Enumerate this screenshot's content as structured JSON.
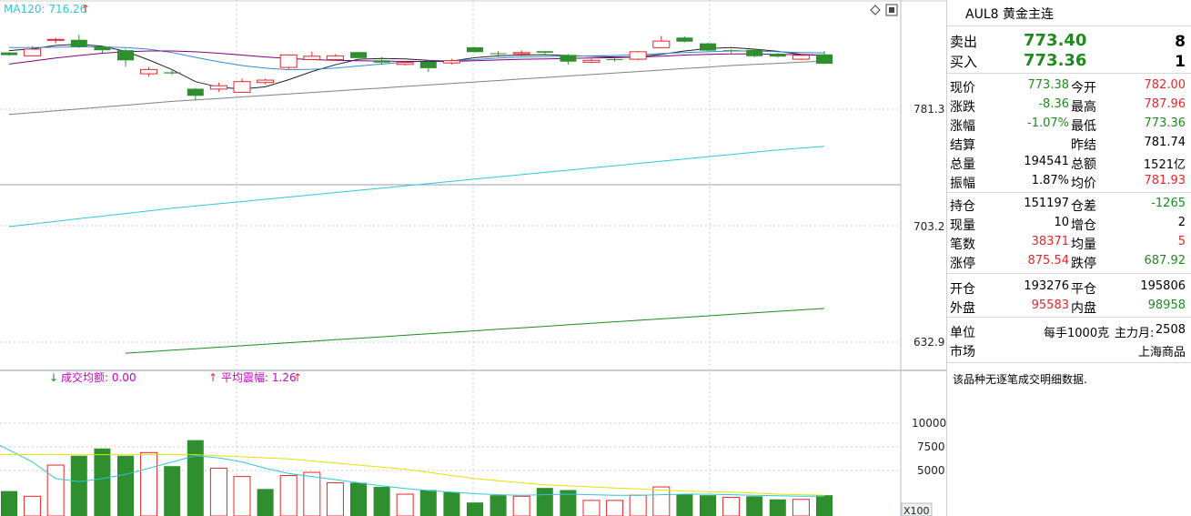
{
  "top_indicator": {
    "label": "MA120: 716.26",
    "arrow": "↑"
  },
  "vol_indicators": {
    "left_arrow": "↓",
    "left": "成交均额: 0.00",
    "right_arrow": "↑",
    "right": "平均震幅: 1.26",
    "right_arrow2": "↑"
  },
  "price_axis": [
    "781.3",
    "703.2",
    "632.9"
  ],
  "vol_axis": [
    "10000",
    "7500",
    "5000"
  ],
  "vol_multiplier": "X100",
  "panel": {
    "title": "AUL8  黄金主连",
    "sell": {
      "label": "卖出",
      "price": "773.40",
      "qty": "8"
    },
    "buy": {
      "label": "买入",
      "price": "773.36",
      "qty": "1"
    },
    "rows": [
      {
        "l1": "现价",
        "v1": "773.38",
        "c1": "green",
        "l2": "今开",
        "v2": "782.00",
        "c2": "red"
      },
      {
        "l1": "涨跌",
        "v1": "-8.36",
        "c1": "green",
        "l2": "最高",
        "v2": "787.96",
        "c2": "red"
      },
      {
        "l1": "涨幅",
        "v1": "-1.07%",
        "c1": "green",
        "l2": "最低",
        "v2": "773.36",
        "c2": "green"
      },
      {
        "l1": "结算",
        "v1": "",
        "c1": "",
        "l2": "昨结",
        "v2": "781.74",
        "c2": ""
      },
      {
        "l1": "总量",
        "v1": "194541",
        "c1": "",
        "l2": "总额",
        "v2": "1521亿",
        "c2": ""
      },
      {
        "l1": "振幅",
        "v1": "1.87%",
        "c1": "",
        "l2": "均价",
        "v2": "781.93",
        "c2": "red"
      }
    ],
    "rows2": [
      {
        "l1": "持仓",
        "v1": "151197",
        "c1": "",
        "l2": "仓差",
        "v2": "-1265",
        "c2": "green"
      },
      {
        "l1": "现量",
        "v1": "10",
        "c1": "",
        "l2": "增仓",
        "v2": "2",
        "c2": ""
      },
      {
        "l1": "笔数",
        "v1": "38371",
        "c1": "red",
        "l2": "均量",
        "v2": "5",
        "c2": "red"
      },
      {
        "l1": "涨停",
        "v1": "875.54",
        "c1": "red",
        "l2": "跌停",
        "v2": "687.92",
        "c2": "green"
      }
    ],
    "rows3": [
      {
        "l1": "开仓",
        "v1": "193276",
        "c1": "",
        "l2": "平仓",
        "v2": "195806",
        "c2": ""
      },
      {
        "l1": "外盘",
        "v1": "95583",
        "c1": "red",
        "l2": "内盘",
        "v2": "98958",
        "c2": "green"
      }
    ],
    "unit": {
      "label": "单位",
      "value": "每手1000克",
      "label2": "主力月:",
      "value2": "2508"
    },
    "market": {
      "label": "市场",
      "value": "上海商品"
    },
    "note": "该品种无逐笔成交明细数据."
  },
  "colors": {
    "up": "#e8262b",
    "down": "#2f8f2f",
    "ma_cyan": "#2ec8d8",
    "ma_green": "#1e8a1e",
    "ma_gray": "#808080",
    "ma_purple": "#800080",
    "ma_black": "#222222",
    "ma_blue": "#3a8ad8",
    "vol_yellow": "#e8e000"
  },
  "chart_data": {
    "type": "candlestick",
    "candles": [
      {
        "o": 781.6,
        "c": 780.2,
        "h": 782.0,
        "l": 779.8
      },
      {
        "o": 779.8,
        "c": 783.4,
        "h": 785.0,
        "l": 779.5
      },
      {
        "o": 788.2,
        "c": 788.6,
        "h": 789.5,
        "l": 786.5
      },
      {
        "o": 788.4,
        "c": 784.6,
        "h": 791.0,
        "l": 784.0
      },
      {
        "o": 784.6,
        "c": 782.8,
        "h": 785.2,
        "l": 781.3
      },
      {
        "o": 782.8,
        "c": 777.4,
        "h": 783.6,
        "l": 774.0
      },
      {
        "o": 770.2,
        "c": 772.5,
        "h": 773.8,
        "l": 768.6
      },
      {
        "o": 771.0,
        "c": 770.4,
        "h": 772.3,
        "l": 769.6
      },
      {
        "o": 762.2,
        "c": 758.4,
        "h": 762.6,
        "l": 756.0
      },
      {
        "o": 762.0,
        "c": 763.8,
        "h": 765.4,
        "l": 760.6
      },
      {
        "o": 760.3,
        "c": 766.0,
        "h": 767.6,
        "l": 760.0
      },
      {
        "o": 765.5,
        "c": 766.8,
        "h": 767.6,
        "l": 764.6
      },
      {
        "o": 773.6,
        "c": 780.3,
        "h": 780.5,
        "l": 772.6
      },
      {
        "o": 777.8,
        "c": 779.6,
        "h": 782.0,
        "l": 777.5
      },
      {
        "o": 777.8,
        "c": 779.8,
        "h": 780.6,
        "l": 777.4
      },
      {
        "o": 781.8,
        "c": 778.6,
        "h": 782.0,
        "l": 778.5
      },
      {
        "o": 777.4,
        "c": 776.2,
        "h": 779.2,
        "l": 775.2
      },
      {
        "o": 775.2,
        "c": 776.2,
        "h": 777.1,
        "l": 774.6
      },
      {
        "o": 776.6,
        "c": 773.2,
        "h": 777.2,
        "l": 771.2
      },
      {
        "o": 776.0,
        "c": 777.2,
        "h": 778.2,
        "l": 775.2
      },
      {
        "o": 784.4,
        "c": 781.8,
        "h": 784.5,
        "l": 781.5
      },
      {
        "o": 781.2,
        "c": 781.0,
        "h": 782.5,
        "l": 779.2
      },
      {
        "o": 780.9,
        "c": 781.5,
        "h": 782.8,
        "l": 779.6
      },
      {
        "o": 782.3,
        "c": 781.5,
        "h": 782.5,
        "l": 780.0
      },
      {
        "o": 780.3,
        "c": 776.7,
        "h": 780.8,
        "l": 775.2
      },
      {
        "o": 776.4,
        "c": 777.4,
        "h": 778.2,
        "l": 775.9
      },
      {
        "o": 778.0,
        "c": 777.6,
        "h": 779.0,
        "l": 776.6
      },
      {
        "o": 778.0,
        "c": 782.0,
        "h": 782.4,
        "l": 777.4
      },
      {
        "o": 784.2,
        "c": 787.7,
        "h": 790.4,
        "l": 783.9
      },
      {
        "o": 789.6,
        "c": 787.4,
        "h": 790.2,
        "l": 787.0
      },
      {
        "o": 786.5,
        "c": 782.6,
        "h": 786.8,
        "l": 782.3
      },
      {
        "o": 782.8,
        "c": 782.5,
        "h": 783.3,
        "l": 781.3
      },
      {
        "o": 783.0,
        "c": 779.6,
        "h": 783.3,
        "l": 779.0
      },
      {
        "o": 780.9,
        "c": 779.4,
        "h": 781.3,
        "l": 778.9
      },
      {
        "o": 778.0,
        "c": 780.1,
        "h": 781.0,
        "l": 777.6
      },
      {
        "o": 780.6,
        "c": 775.6,
        "h": 782.4,
        "l": 775.3
      }
    ],
    "volumes": [
      {
        "v": 2400,
        "d": "down"
      },
      {
        "v": 1900,
        "d": "up"
      },
      {
        "v": 4900,
        "d": "up"
      },
      {
        "v": 5800,
        "d": "down"
      },
      {
        "v": 6500,
        "d": "down"
      },
      {
        "v": 5800,
        "d": "down"
      },
      {
        "v": 6100,
        "d": "up"
      },
      {
        "v": 4800,
        "d": "down"
      },
      {
        "v": 7300,
        "d": "down"
      },
      {
        "v": 4600,
        "d": "up"
      },
      {
        "v": 3800,
        "d": "up"
      },
      {
        "v": 2600,
        "d": "down"
      },
      {
        "v": 3900,
        "d": "up"
      },
      {
        "v": 4200,
        "d": "up"
      },
      {
        "v": 3200,
        "d": "up"
      },
      {
        "v": 3200,
        "d": "down"
      },
      {
        "v": 2800,
        "d": "down"
      },
      {
        "v": 2100,
        "d": "up"
      },
      {
        "v": 2500,
        "d": "down"
      },
      {
        "v": 2300,
        "d": "down"
      },
      {
        "v": 1300,
        "d": "down"
      },
      {
        "v": 2000,
        "d": "down"
      },
      {
        "v": 1900,
        "d": "up"
      },
      {
        "v": 2700,
        "d": "down"
      },
      {
        "v": 2500,
        "d": "down"
      },
      {
        "v": 1500,
        "d": "up"
      },
      {
        "v": 1500,
        "d": "up"
      },
      {
        "v": 2000,
        "d": "up"
      },
      {
        "v": 2800,
        "d": "up"
      },
      {
        "v": 2100,
        "d": "down"
      },
      {
        "v": 2000,
        "d": "down"
      },
      {
        "v": 1800,
        "d": "up"
      },
      {
        "v": 1900,
        "d": "down"
      },
      {
        "v": 1600,
        "d": "down"
      },
      {
        "v": 1600,
        "d": "up"
      },
      {
        "v": 2000,
        "d": "down"
      }
    ],
    "price_range": [
      611.4,
      809.7
    ],
    "volume_range": [
      0,
      12000
    ],
    "ma_lines": [
      {
        "color": "ma_black",
        "values": [
          782.6,
          783.6,
          785.4,
          786.0,
          785.0,
          782.2,
          777.6,
          772.4,
          766.0,
          763.0,
          762.0,
          763.2,
          767.0,
          771.4,
          775.0,
          778.0,
          778.4,
          778.2,
          777.4,
          777.0,
          778.8,
          779.8,
          780.2,
          780.4,
          780.0,
          779.6,
          779.2,
          779.2,
          780.6,
          782.4,
          783.8,
          784.2,
          783.4,
          782.2,
          780.6,
          780.0
        ]
      },
      {
        "color": "ma_blue",
        "values": [
          784.2,
          784.2,
          784.4,
          784.6,
          784.6,
          784.2,
          783.4,
          781.6,
          779.0,
          776.6,
          774.6,
          773.2,
          772.4,
          772.6,
          773.2,
          774.4,
          775.4,
          776.4,
          777.0,
          777.2,
          777.8,
          778.6,
          779.2,
          779.4,
          779.6,
          779.8,
          780.0,
          780.4,
          781.0,
          781.6,
          782.0,
          782.4,
          782.4,
          782.0,
          781.6,
          781.4
        ]
      },
      {
        "color": "ma_purple",
        "values": [
          775.4,
          777.0,
          778.6,
          780.0,
          781.2,
          782.0,
          782.4,
          782.4,
          782.0,
          781.2,
          780.2,
          779.2,
          778.4,
          777.8,
          777.4,
          777.2,
          777.0,
          776.8,
          776.8,
          776.8,
          777.2,
          777.6,
          778.0,
          778.2,
          778.4,
          778.6,
          778.8,
          779.2,
          779.6,
          780.2,
          780.6,
          780.8,
          780.8,
          780.6,
          780.4,
          780.2
        ]
      },
      {
        "color": "ma_gray",
        "values": [
          748.4,
          749.4,
          750.4,
          751.4,
          752.4,
          753.4,
          754.4,
          755.4,
          756.2,
          757.0,
          757.8,
          758.6,
          759.4,
          760.2,
          761.0,
          761.8,
          762.6,
          763.4,
          764.2,
          765.0,
          765.8,
          766.6,
          767.4,
          768.2,
          769.0,
          769.8,
          770.6,
          771.4,
          772.2,
          773.0,
          773.8,
          774.6,
          775.2,
          775.8,
          776.4,
          777.0
        ]
      },
      {
        "color": "ma_cyan",
        "values": [
          688.4,
          689.8,
          691.2,
          692.6,
          694.0,
          695.4,
          696.8,
          698.2,
          699.4,
          700.6,
          701.8,
          703.0,
          704.2,
          705.4,
          706.6,
          707.8,
          709.0,
          710.2,
          711.4,
          712.6,
          713.8,
          715.0,
          716.2,
          717.4,
          718.6,
          719.8,
          721.0,
          722.2,
          723.4,
          724.6,
          725.8,
          727.0,
          728.2,
          729.4,
          730.4,
          731.4
        ]
      },
      {
        "color": "ma_green",
        "values": [
          null,
          null,
          null,
          null,
          null,
          620.6,
          621.4,
          622.2,
          623.0,
          623.8,
          624.6,
          625.4,
          626.2,
          627.0,
          627.8,
          628.6,
          629.4,
          630.2,
          631.0,
          631.8,
          632.6,
          633.4,
          634.2,
          635.0,
          635.8,
          636.6,
          637.4,
          638.2,
          639.0,
          639.8,
          640.6,
          641.4,
          642.2,
          643.0,
          643.8,
          644.6
        ]
      }
    ],
    "vol_lines": [
      {
        "color": "ma_cyan",
        "values": [
          6800,
          5200,
          3600,
          3300,
          3600,
          4000,
          4600,
          5200,
          5800,
          5600,
          5200,
          4600,
          4100,
          3800,
          3500,
          3200,
          2900,
          2650,
          2450,
          2300,
          2150,
          2050,
          2000,
          2050,
          2100,
          2050,
          2000,
          2000,
          2050,
          2100,
          2100,
          2050,
          2000,
          1950,
          1900,
          1900
        ]
      },
      {
        "color": "ma_yellow",
        "values": [
          5900,
          5900,
          5900,
          5900,
          5900,
          5900,
          5900,
          5900,
          5900,
          5800,
          5700,
          5600,
          5500,
          5300,
          5100,
          4900,
          4700,
          4500,
          4200,
          3900,
          3600,
          3400,
          3200,
          3000,
          2900,
          2800,
          2700,
          2600,
          2500,
          2400,
          2350,
          2300,
          2200,
          2100,
          2050,
          2000
        ]
      }
    ]
  }
}
